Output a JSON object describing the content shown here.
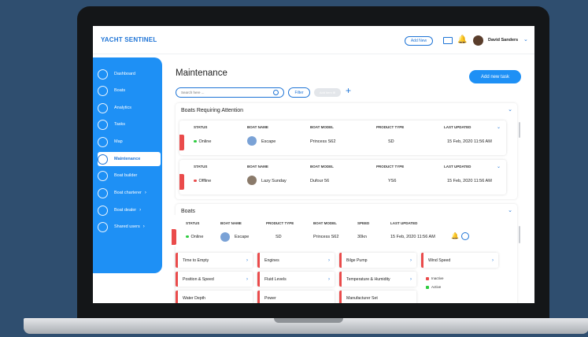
{
  "header": {
    "logo": "YACHT SENTINEL",
    "add_new": "Add New",
    "user_name": "David Sanders"
  },
  "sidebar": {
    "items": [
      {
        "label": "Dashboard",
        "icon": "gauge-icon"
      },
      {
        "label": "Boats",
        "icon": "boat-icon"
      },
      {
        "label": "Analytics",
        "icon": "chart-icon"
      },
      {
        "label": "Tasks",
        "icon": "clipboard-icon"
      },
      {
        "label": "Map",
        "icon": "globe-icon"
      },
      {
        "label": "Maintenance",
        "icon": "wrench-icon",
        "active": true
      },
      {
        "label": "Boat builder",
        "icon": "hammer-icon"
      },
      {
        "label": "Boat charterer",
        "icon": "person-icon",
        "chevron": true
      },
      {
        "label": "Boat dealer",
        "icon": "handshake-icon",
        "chevron": true
      },
      {
        "label": "Shared users",
        "icon": "users-icon",
        "chevron": true
      }
    ]
  },
  "main": {
    "title": "Maintenance",
    "add_task": "Add new task",
    "search_placeholder": "Search here ...",
    "filter": "Filter",
    "chip": "Add item ⊗"
  },
  "attention": {
    "title": "Boats Requiring Attention",
    "headers": [
      "STATUS",
      "BOAT NAME",
      "BOAT MODEL",
      "PRODUCT TYPE",
      "LAST UPDATED"
    ],
    "rows": [
      {
        "status": "Online",
        "name": "Escape",
        "model": "Princess S62",
        "type": "SD",
        "updated": "15 Feb, 2020 11:56 AM",
        "status_color": "#2ecc40"
      },
      {
        "status": "Offline",
        "name": "Lazy Sunday",
        "model": "Dufour 56",
        "type": "YS6",
        "updated": "15 Feb, 2020 11:56 AM",
        "status_color": "#ea4b4b"
      }
    ]
  },
  "boats": {
    "title": "Boats",
    "headers": [
      "STATUS",
      "BOAT NAME",
      "PRODUCT TYPE",
      "BOAT MODEL",
      "SPEED",
      "LAST UPDATED"
    ],
    "row": {
      "status": "Online",
      "name": "Escape",
      "type": "SD",
      "model": "Princess S62",
      "speed": "30kn",
      "updated": "15 Feb, 2020 11:56 AM"
    },
    "tiles": [
      [
        "Time to Empty",
        "Engines",
        "Bilge Pump",
        "Wind Speed"
      ],
      [
        "Position & Speed",
        "Fluid Levels",
        "Temperature & Humidity"
      ],
      [
        "Water Depth",
        "Power",
        "Manufacturer Set"
      ]
    ],
    "legend": [
      {
        "label": "Inactive",
        "color": "#ea4b4b"
      },
      {
        "label": "Active",
        "color": "#2ecc40"
      }
    ]
  }
}
